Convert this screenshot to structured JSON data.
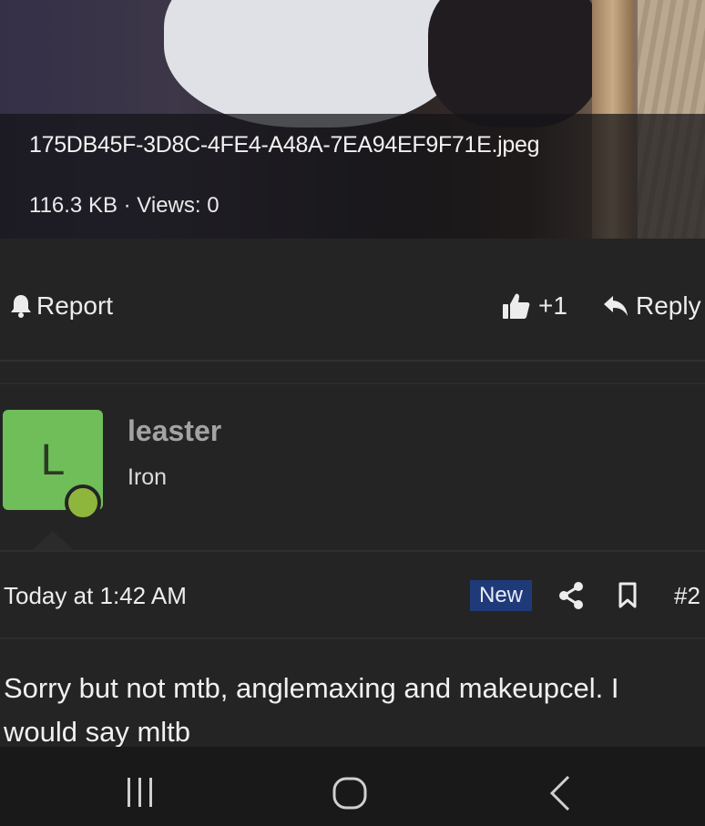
{
  "attachment": {
    "filename": "175DB45F-3D8C-4FE4-A48A-7EA94EF9F71E.jpeg",
    "meta": "116.3 KB · Views: 0"
  },
  "actions": {
    "report_label": "Report",
    "like_count": "+1",
    "reply_label": "Reply"
  },
  "post": {
    "avatar_letter": "L",
    "username": "leaster",
    "user_title": "Iron",
    "date": "Today at 1:42 AM",
    "badge": "New",
    "post_number": "#2",
    "message": "Sorry but not mtb, anglemaxing and makeupcel. I would say mltb"
  },
  "colors": {
    "background": "#242424",
    "avatar_bg": "#6fbe5a",
    "online_dot": "#8fb63c",
    "badge_bg": "#1f3a78",
    "navbar_bg": "#191919"
  },
  "icons": [
    "bell-icon",
    "thumbs-up-icon",
    "reply-arrow-icon",
    "share-icon",
    "bookmark-icon",
    "recent-apps-icon",
    "home-icon",
    "back-icon"
  ]
}
